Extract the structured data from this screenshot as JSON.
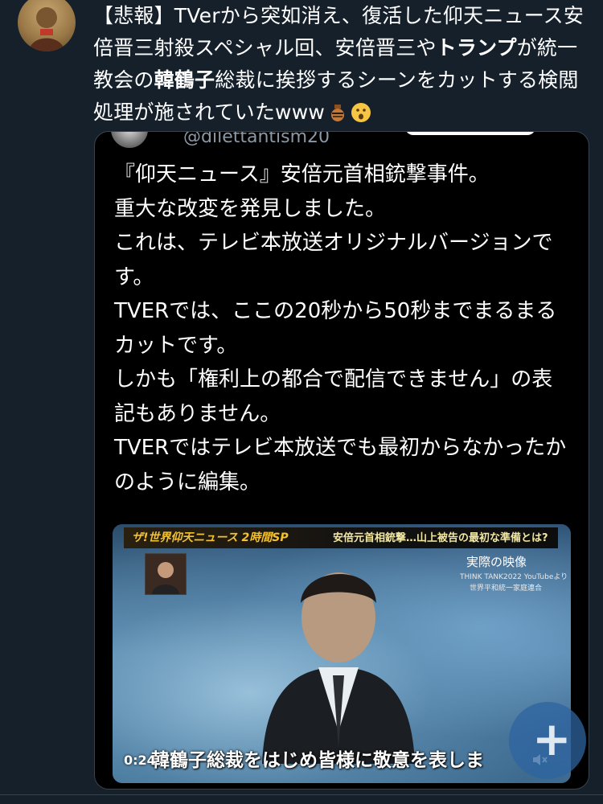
{
  "tweet": {
    "text_1": "【悲報】TVerから突如消え、復活した仰天ニュース安倍晋三射殺スペシャル回、安倍晋三や",
    "bold_1": "トランプ",
    "text_2": "が統一教会の",
    "bold_2": "韓鶴子",
    "text_3": "総裁に挨拶するシーンをカットする検閲処理が施されていたwww",
    "emoji_1": "urn-emoji",
    "emoji_2": "astonished-face-emoji"
  },
  "quote": {
    "handle": "@dilettantism20",
    "lines": [
      "『仰天ニュース』安倍元首相銃撃事件。",
      "重大な改変を発見しました。",
      "これは、テレビ本放送オリジナルバージョンです。",
      "TVERでは、ここの20秒から50秒までまるまるカットです。",
      "しかも「権利上の都合で配信できません」の表記もありません。",
      "TVERではテレビ本放送でも最初からなかったかのように編集。"
    ]
  },
  "video": {
    "show_title": "ザ!世界仰天ニュース 2時間SP",
    "headline": "安倍元首相銃撃…山上被告の最初な準備とは?",
    "label": "実際の映像",
    "credit_1": "THINK TANK2022 YouTubeより",
    "credit_2": "世界平和統一家庭連合",
    "subtitle": "韓鶴子総裁をはじめ皆様に敬意を表しま",
    "timestamp": "0:24"
  },
  "fab": {
    "label": "+"
  },
  "colors": {
    "background": "#15202b",
    "card_bg": "#000000",
    "border": "#38444d",
    "muted": "#8b98a5"
  }
}
